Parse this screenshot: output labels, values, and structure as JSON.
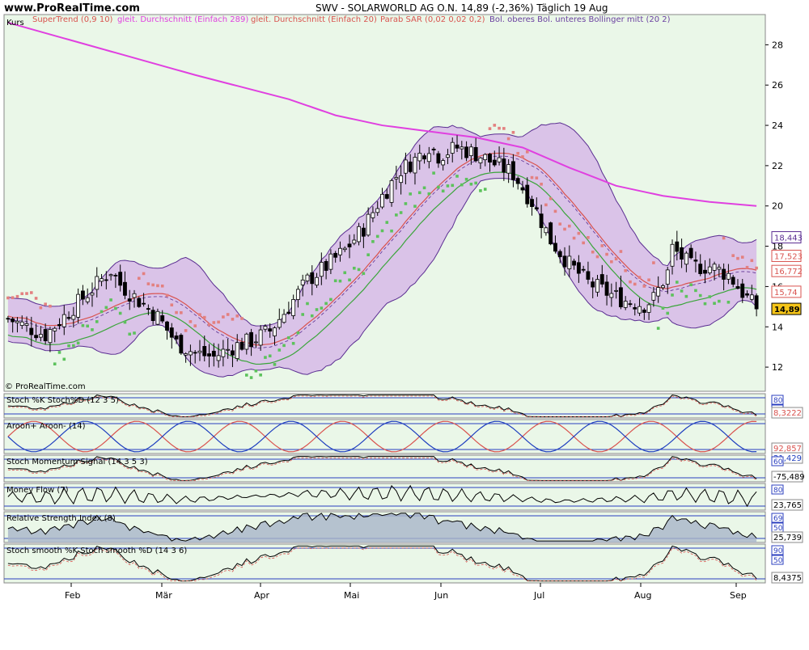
{
  "header": {
    "watermark": "www.ProRealTime.com",
    "title": "SWV - SOLARWORLD AG O.N.    14,89 (-2,36%)    Täglich  19 Aug",
    "kurs_label": "Kurs",
    "copyright": "© ProRealTime.com"
  },
  "legend": [
    {
      "text": "SuperTrend (0,9 10)",
      "color": "#d9534f"
    },
    {
      "text": "gleit. Durchschnitt (Einfach 289)",
      "color": "#e040e0"
    },
    {
      "text": "gleit. Durchschnitt (Einfach 20)",
      "color": "#d9534f"
    },
    {
      "text": "Parab SAR (0,02 0,02 0,2)",
      "color": "#d9534f"
    },
    {
      "text": "Bol. oberes Bol. unteres Bollinger mitt (20 2)",
      "color": "#6a3fa0"
    }
  ],
  "colors": {
    "plot_bg": "#eaf7e8",
    "bollinger_fill": "#d8bde8",
    "bollinger_line": "#5a2d91",
    "sma289": "#e040e0",
    "sma20": "#d9534f",
    "sar_above": "#e38080",
    "sar_below": "#5cc25c",
    "supertrend_up": "#3aa53a",
    "supertrend_down": "#d9534f"
  },
  "chart_data": {
    "type": "candlestick",
    "x_month_labels": [
      "Feb",
      "Mär",
      "Apr",
      "Mai",
      "Jun",
      "Jul",
      "Aug",
      "Sep"
    ],
    "y_ticks": [
      "12",
      "14",
      "16",
      "18",
      "20",
      "22",
      "24",
      "26",
      "28"
    ],
    "ylim": [
      10.8,
      29.5
    ],
    "close_path": [
      [
        0,
        14.4
      ],
      [
        8,
        13.6
      ],
      [
        15,
        15.2
      ],
      [
        22,
        16.8
      ],
      [
        24,
        16.1
      ],
      [
        28,
        15.3
      ],
      [
        32,
        14.5
      ],
      [
        36,
        13.2
      ],
      [
        40,
        12.7
      ],
      [
        44,
        12.5
      ],
      [
        48,
        13.0
      ],
      [
        52,
        13.3
      ],
      [
        56,
        13.8
      ],
      [
        60,
        15.0
      ],
      [
        64,
        16.3
      ],
      [
        68,
        17.0
      ],
      [
        72,
        17.8
      ],
      [
        76,
        18.9
      ],
      [
        80,
        20.5
      ],
      [
        84,
        21.8
      ],
      [
        87,
        22.3
      ],
      [
        90,
        23.0
      ],
      [
        92,
        22.5
      ],
      [
        96,
        22.9
      ],
      [
        100,
        22.6
      ],
      [
        104,
        22.1
      ],
      [
        108,
        21.6
      ],
      [
        112,
        20.2
      ],
      [
        116,
        18.3
      ],
      [
        120,
        17.1
      ],
      [
        124,
        16.2
      ],
      [
        128,
        15.7
      ],
      [
        132,
        15.3
      ],
      [
        136,
        15.1
      ],
      [
        138,
        15.4
      ],
      [
        141,
        16.7
      ],
      [
        142,
        17.9
      ],
      [
        146,
        17.0
      ],
      [
        150,
        17.0
      ],
      [
        154,
        16.6
      ],
      [
        157,
        15.7
      ],
      [
        160,
        14.89
      ]
    ],
    "high_noise": [
      0.9,
      0.6
    ],
    "low_noise": [
      0.9,
      0.6
    ],
    "sma289": [
      [
        0,
        29.1
      ],
      [
        20,
        27.8
      ],
      [
        40,
        26.5
      ],
      [
        60,
        25.3
      ],
      [
        70,
        24.5
      ],
      [
        80,
        24.0
      ],
      [
        90,
        23.7
      ],
      [
        100,
        23.4
      ],
      [
        110,
        22.9
      ],
      [
        120,
        21.9
      ],
      [
        130,
        21.0
      ],
      [
        140,
        20.5
      ],
      [
        150,
        20.2
      ],
      [
        160,
        20.0
      ]
    ],
    "last_price_tag": "14,89",
    "right_tags": [
      {
        "value": 18.443,
        "label": "18,443",
        "color": "#5a2d91"
      },
      {
        "value": 17.523,
        "label": "17,523",
        "color": "#d9534f"
      },
      {
        "value": 16.772,
        "label": "16,772",
        "color": "#d9534f"
      },
      {
        "value": 15.74,
        "label": "15,74",
        "color": "#d9534f"
      },
      {
        "value": 14.89,
        "label": "14,89",
        "color": "#000000",
        "fill": "#f5c518"
      }
    ]
  },
  "sub_panels": [
    {
      "name": "stoch-k-d",
      "label": "Stoch %K Stoch%D (12 3 5)",
      "levels": [
        "80",
        "0"
      ],
      "value": "8,3222",
      "value_color": "#d9534f",
      "type": "stoch"
    },
    {
      "name": "aroon",
      "label": "Aroon+ Aroon- (14)",
      "value": "92,857",
      "value2": "21,429",
      "value_color": "#d9534f",
      "value2_color": "#1f3fbf",
      "type": "aroon"
    },
    {
      "name": "stoch-momentum",
      "label": "Stoch Momentum Signal (14 3 5 3)",
      "levels": [
        "60"
      ],
      "value": "-75,489",
      "value_color": "#000000",
      "type": "line"
    },
    {
      "name": "money-flow",
      "label": "Money Flow (7)",
      "levels": [
        "80"
      ],
      "value": "23,765",
      "value_color": "#000000",
      "type": "mfi"
    },
    {
      "name": "rsi",
      "label": "Relative Strength Index (8)",
      "levels": [
        "69",
        "50"
      ],
      "value": "25,739",
      "value_color": "#000000",
      "type": "rsi"
    },
    {
      "name": "stoch-smooth",
      "label": "Stoch smooth %K Stoch smooth %D (14 3 6)",
      "levels": [
        "90",
        "50"
      ],
      "value": "8,4375",
      "value_color": "#000000",
      "type": "stoch"
    }
  ]
}
